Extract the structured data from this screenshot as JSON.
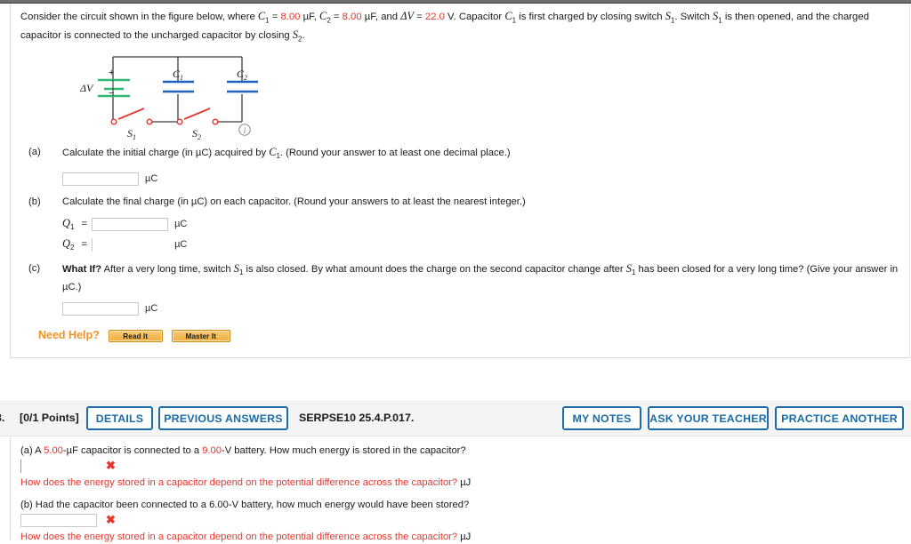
{
  "question2": {
    "prompt": {
      "lead": "Consider the circuit shown in the figure below, where ",
      "c1_label": "C",
      "c1_sub": "1",
      "eq1": " = ",
      "c1_value": "8.00",
      "unit1": " µF, ",
      "c2_label": "C",
      "c2_sub": "2",
      "eq2": " = ",
      "c2_value": "8.00",
      "unit2": " µF, and ",
      "dv_label": "ΔV",
      "eq3": " = ",
      "dv_value": "22.0",
      "unit3": " V. Capacitor ",
      "mid1": "C",
      "mid1_sub": "1",
      "mid2": " is first charged by closing switch ",
      "s1": "S",
      "s1_sub": "1",
      "mid3": ". Switch ",
      "s1b": "S",
      "s1b_sub": "1",
      "tail": " is then opened, and the charged capacitor is connected to the uncharged capacitor by closing ",
      "s2": "S",
      "s2_sub": "2",
      "period": "."
    },
    "figure": {
      "source_voltage_label": "ΔV",
      "plus_label": "+",
      "minus_label": "−",
      "cap1_label": "C",
      "cap1_sub": "1",
      "cap2_label": "C",
      "cap2_sub": "2",
      "switch1_label": "S",
      "switch1_sub": "1",
      "switch2_label": "S",
      "switch2_sub": "2",
      "info_glyph": "i",
      "battery_color": "#2eb872",
      "capacitor_color": "#1f5fbf",
      "switch_color": "#e8352a",
      "wire_color": "#3a3a3a"
    },
    "parts": [
      {
        "tag": "(a)",
        "text_before": "Calculate the initial charge (in µC) acquired by ",
        "symbol": "C",
        "symbol_sub": "1",
        "text_after": ". (Round your answer to at least one decimal place.)",
        "input_value": "",
        "unit": "µC"
      },
      {
        "tag": "(b)",
        "text_before": "Calculate the final charge (in µC) on each capacitor. (Round your answers to at least the nearest integer.)",
        "symbol": "",
        "symbol_sub": "",
        "text_after": "",
        "rows": [
          {
            "label": "Q",
            "label_sub": "1",
            "eq": "=",
            "input_value": "",
            "unit": "µC"
          },
          {
            "label": "Q",
            "label_sub": "2",
            "eq": "=",
            "input_value": "",
            "unit": "µC"
          }
        ]
      },
      {
        "tag": "(c)",
        "bold_lead": "What If?",
        "text_before": " After a very long time, switch ",
        "symbol": "S",
        "symbol_sub": "1",
        "text_mid": " is also closed. By what amount does the charge on the second capacitor change after ",
        "symbol2": "S",
        "symbol2_sub": "1",
        "text_after": " has been closed for a very long time? (Give your answer in µC.)",
        "input_value": "",
        "unit": "µC"
      }
    ],
    "need_help": {
      "label": "Need Help?",
      "read_it": "Read It",
      "master_it": "Master It"
    }
  },
  "question3": {
    "number": "3.",
    "points": "[0/1 Points]",
    "details_button": "DETAILS",
    "previous_answers_button": "PREVIOUS ANSWERS",
    "serial": "SERPSE10 25.4.P.017.",
    "my_notes_button": "MY NOTES",
    "ask_teacher_button": "ASK YOUR TEACHER",
    "practice_another_button": "PRACTICE ANOTHER",
    "accent_color": "#1b6ca8",
    "parts": [
      {
        "tag": "(a) A ",
        "value1": "5.00",
        "text1": "-µF capacitor is connected to a ",
        "value2": "9.00",
        "text2": "-V battery. How much energy is stored in the capacitor?",
        "input_value": "",
        "mark": "✖",
        "feedback": "How does the energy stored in a capacitor depend on the potential difference across the capacitor?",
        "feedback_unit": "µJ"
      },
      {
        "tag": "(b) Had the capacitor been connected to a 6.00-V battery, how much energy would have been stored?",
        "value1": "",
        "text1": "",
        "value2": "",
        "text2": "",
        "input_value": "",
        "mark": "✖",
        "feedback": "How does the energy stored in a capacitor depend on the potential difference across the capacitor?",
        "feedback_unit": "µJ"
      }
    ]
  }
}
